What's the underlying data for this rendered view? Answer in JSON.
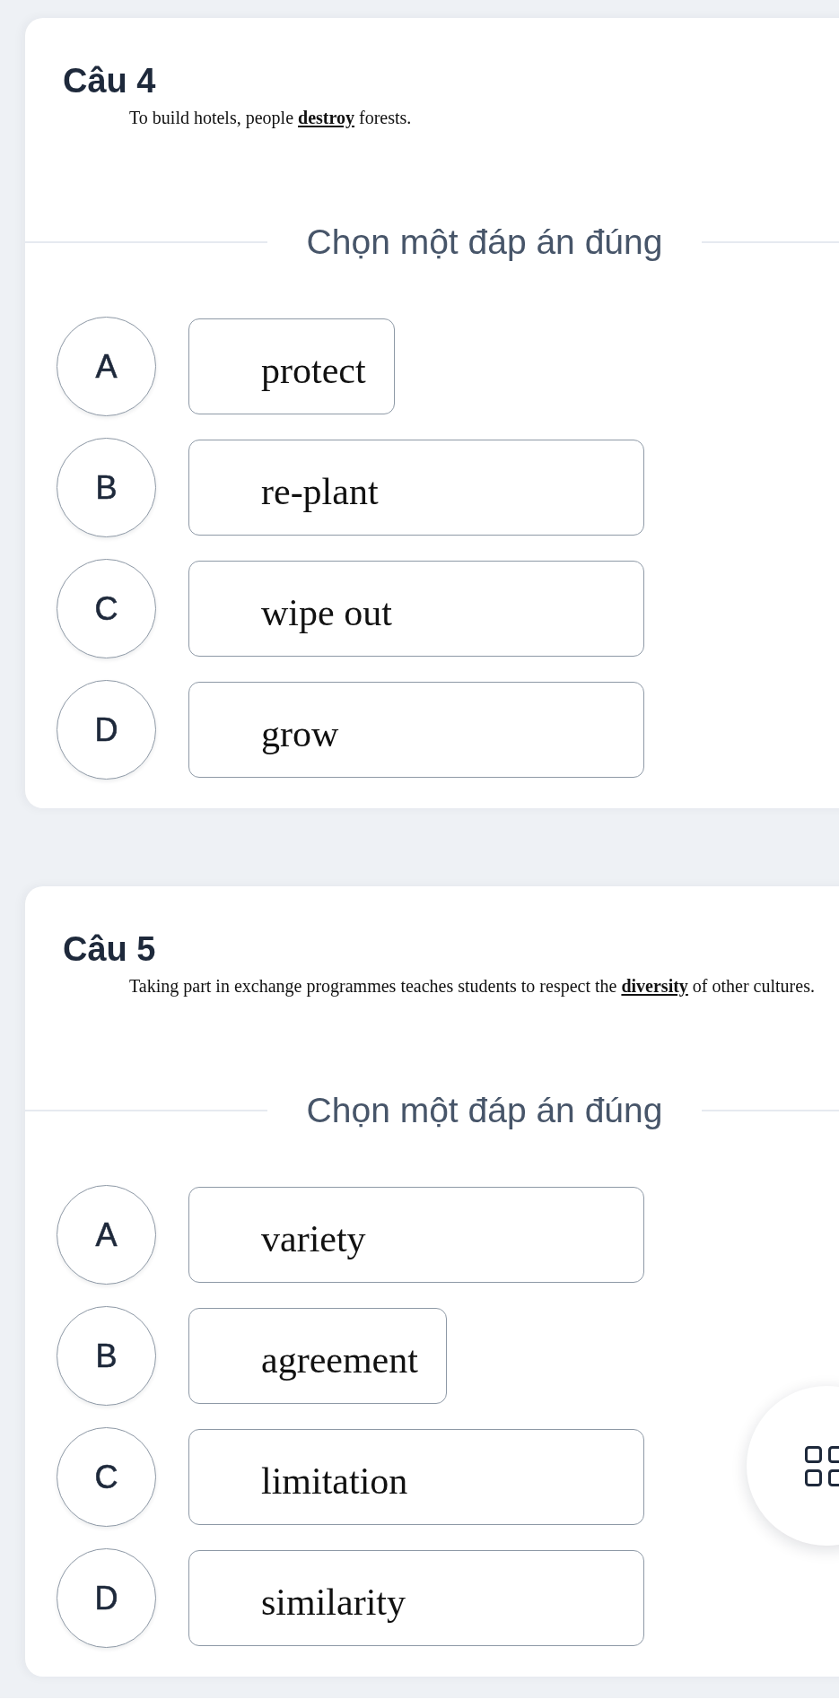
{
  "questions": [
    {
      "title": "Câu 4",
      "prompt": "To build hotels, people **destroy** forests.",
      "instruction": "Chọn một đáp án đúng",
      "options": [
        {
          "letter": "A",
          "text": "protect",
          "kind": "compact",
          "selected": false
        },
        {
          "letter": "B",
          "text": "re-plant",
          "kind": "wide",
          "selected": false
        },
        {
          "letter": "C",
          "text": "wipe out",
          "kind": "wide",
          "selected": false
        },
        {
          "letter": "D",
          "text": "grow",
          "kind": "wide",
          "selected": false
        }
      ]
    },
    {
      "title": "Câu 5",
      "prompt": "Taking part in exchange programmes teaches students to respect the **diversity** of other cultures.",
      "instruction": "Chọn một đáp án đúng",
      "options": [
        {
          "letter": "A",
          "text": "variety",
          "kind": "wide",
          "selected": false
        },
        {
          "letter": "B",
          "text": "agreement",
          "kind": "compact",
          "selected": false
        },
        {
          "letter": "C",
          "text": "limitation",
          "kind": "wide",
          "selected": false
        },
        {
          "letter": "D",
          "text": "similarity",
          "kind": "wide",
          "selected": false
        }
      ]
    }
  ]
}
